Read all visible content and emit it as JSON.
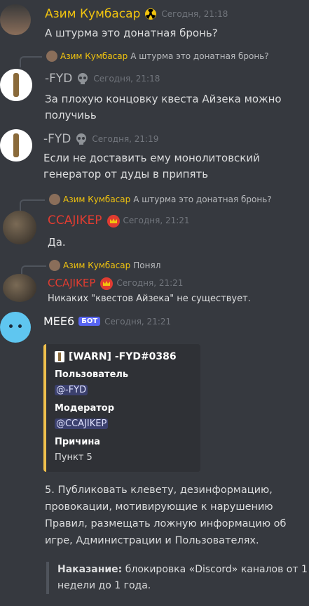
{
  "messages": {
    "m1": {
      "author": "Азим Кумбасар",
      "badge": "radioactive-icon",
      "time": "Сегодня, 21:18",
      "text": "А штурма это донатная бронь?",
      "name_color": "#f1c40f"
    },
    "r1": {
      "author": "Азим Кумбасар",
      "text": "А штурма это донатная бронь?"
    },
    "m2": {
      "author": "-FYD",
      "badge": "skull-icon",
      "time": "Сегодня, 21:18",
      "text": "За плохую концовку квеста Айзека можно получиьь",
      "name_color": "#b9bbbe"
    },
    "m3": {
      "author": "-FYD",
      "badge": "skull-icon",
      "time": "Сегодня, 21:19",
      "text": "Если не доставить ему монолитовский генератор от дуды в припять",
      "name_color": "#b9bbbe"
    },
    "r2": {
      "author": "Азим Кумбасар",
      "text": "А штурма это донатная бронь?"
    },
    "m4": {
      "author": "CCAJIKEP",
      "badge": "crown-icon",
      "time": "Сегодня, 21:21",
      "text": "Да.",
      "name_color": "#e03c31"
    },
    "r3": {
      "author": "Азим Кумбасар",
      "text": "Понял"
    },
    "m5": {
      "author": "CCAJIKEP",
      "badge": "crown-icon",
      "time": "Сегодня, 21:21",
      "text": "Никаких \"квестов Айзека\" не существует.",
      "name_color": "#e03c31"
    },
    "m6": {
      "author": "MEE6",
      "bot_tag": "БОТ",
      "time": "Сегодня, 21:21",
      "name_color": "#ffffff"
    }
  },
  "embed": {
    "title": "[WARN] -FYD#0386",
    "field1_label": "Пользователь",
    "field1_value": "@-FYD",
    "field2_label": "Модератор",
    "field2_value": "@CCAJIKEP",
    "field3_label": "Причина",
    "field3_value": "Пункт 5",
    "accent": "#f0c04c"
  },
  "rule": {
    "text": "5. Публиковать клевету, дезинформацию, провокации, мотивирующие к нарушению Правил, размещать ложную информацию об игре, Администрации и Пользователях.",
    "punishment_label": "Наказание:",
    "punishment_text": " блокировка «Discord» каналов от 1 недели до 1 года."
  }
}
